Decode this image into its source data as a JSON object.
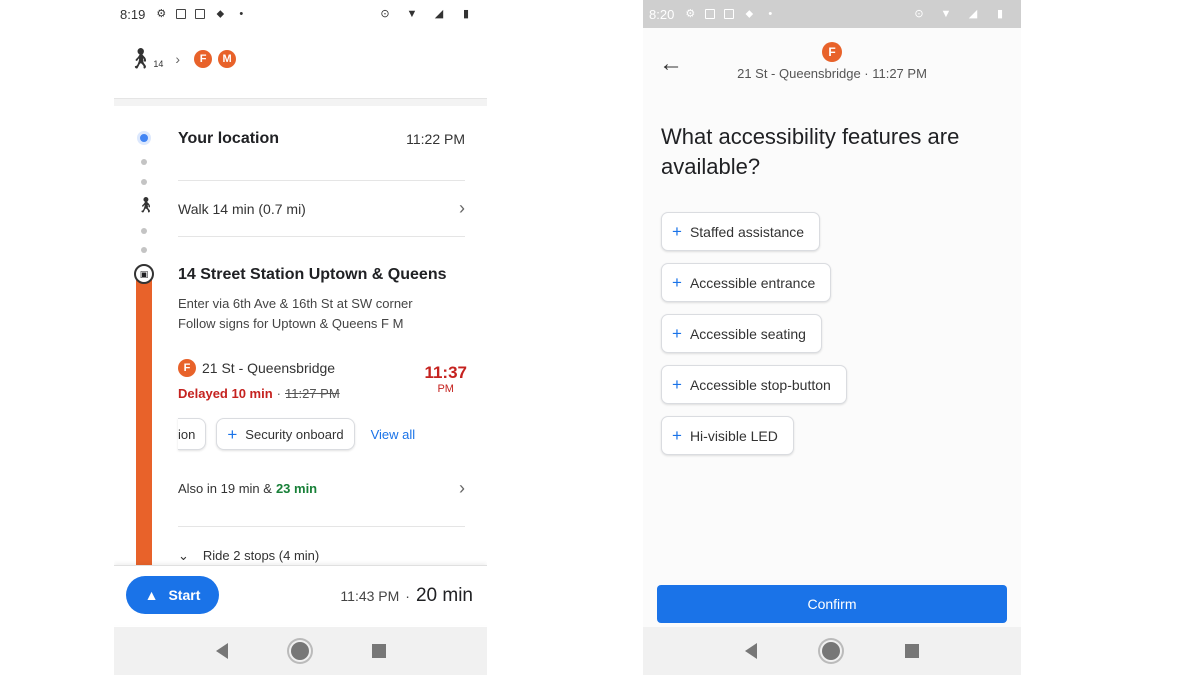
{
  "left": {
    "status": {
      "time": "8:19"
    },
    "route_summary": {
      "walk_minutes": "14",
      "lines": [
        "F",
        "M"
      ]
    },
    "origin": {
      "label": "Your location",
      "time": "11:22 PM"
    },
    "walk": {
      "label": "Walk 14 min (0.7 mi)"
    },
    "station": {
      "name": "14 Street Station Uptown & Queens",
      "line1": "Enter via 6th Ave & 16th St at SW corner",
      "line2": "Follow signs for Uptown & Queens F M"
    },
    "departure": {
      "line": "F",
      "destination": "21 St - Queensbridge",
      "delay": "Delayed 10 min",
      "separator": "·",
      "old_time": "11:27 PM",
      "new_time": "11:37",
      "new_ampm": "PM"
    },
    "chips": {
      "partial": "ion",
      "security": "Security onboard",
      "view_all": "View all"
    },
    "also": {
      "prefix": "Also in 19 min &",
      "green": "23 min"
    },
    "ride": {
      "label": "Ride 2 stops (4 min)"
    },
    "bottom": {
      "start": "Start",
      "arrive": "11:43 PM",
      "separator": "·",
      "duration": "20 min"
    }
  },
  "right": {
    "status": {
      "time": "8:20"
    },
    "header": {
      "line": "F",
      "subtitle": "21 St - Queensbridge · 11:27 PM"
    },
    "question": "What accessibility features are available?",
    "features": [
      "Staffed assistance",
      "Accessible entrance",
      "Accessible seating",
      "Accessible stop-button",
      "Hi-visible LED"
    ],
    "confirm": "Confirm"
  },
  "colors": {
    "accent": "#1a73e8",
    "line_f": "#e8622a",
    "delay": "#c5221f",
    "green": "#188038"
  }
}
